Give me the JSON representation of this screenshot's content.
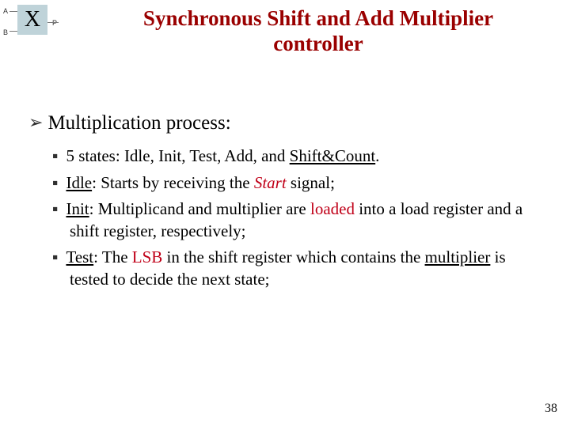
{
  "icon": {
    "labelA": "A",
    "labelB": "B",
    "labelP": "P",
    "symbol": "X"
  },
  "title_line1": "Synchronous Shift and Add Multiplier",
  "title_line2": "controller",
  "heading": "Multiplication process:",
  "bullets": {
    "b1_pre": "5 states: Idle, Init, Test, Add, and ",
    "b1_under": "Shift&Count",
    "b1_post": ".",
    "b2_under": "Idle",
    "b2_pre": ": Starts by receiving the ",
    "b2_red": "Start",
    "b2_post": " signal;",
    "b3_under": "Init",
    "b3_pre": ": Multiplicand and multiplier are ",
    "b3_red": "loaded",
    "b3_post": " into a load register and a shift register, respectively;",
    "b4_under": "Test",
    "b4_pre": ": The ",
    "b4_red": "LSB",
    "b4_mid": " in the shift register which contains the ",
    "b4_under2": "multiplier",
    "b4_post": " is tested to decide the next state;"
  },
  "pagenum": "38"
}
